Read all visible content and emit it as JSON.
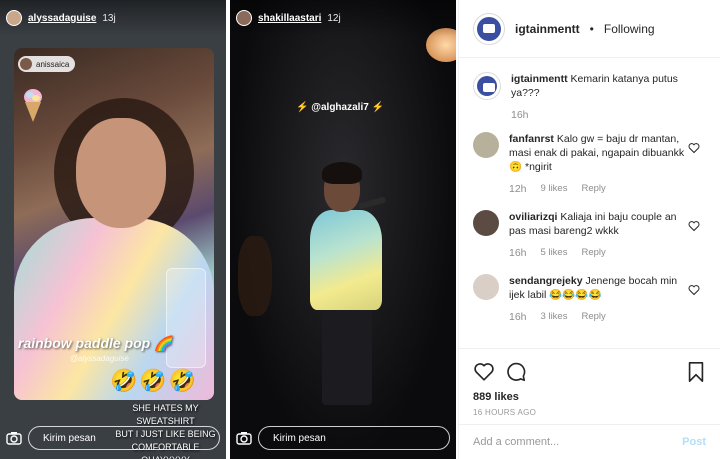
{
  "story_left": {
    "username": "alyssadaguise",
    "time": "13j",
    "mention_user": "anissaica",
    "sticker_text": "rainbow paddle pop",
    "sticker_mention": "@alyssadaguise",
    "emojis": "🤣🤣🤣",
    "caption": [
      "SHE HATES MY SWEATSHIRT",
      "BUT I JUST LIKE BEING",
      "COMFORTABLE OHAYYYYY"
    ],
    "message_placeholder": "Kirim pesan"
  },
  "story_mid": {
    "username": "shakillaastari",
    "time": "12j",
    "mention": "⚡ @alghazali7 ⚡",
    "message_placeholder": "Kirim pesan"
  },
  "post": {
    "username": "igtainmentt",
    "separator": "•",
    "follow_status": "Following",
    "caption": {
      "user": "igtainmentt",
      "text": "Kemarin katanya putus ya???",
      "time": "16h"
    },
    "comments": [
      {
        "user": "fanfanrst",
        "text": "Kalo gw = baju dr mantan, masi enak di pakai, ngapain dibuankk 🙃 *ngirit",
        "time": "12h",
        "likes": "9 likes",
        "reply": "Reply"
      },
      {
        "user": "oviliarizqi",
        "text": "Kaliaja ini baju couple an pas masi bareng2 wkkk",
        "time": "16h",
        "likes": "5 likes",
        "reply": "Reply"
      },
      {
        "user": "sendangrejeky",
        "text": "Jenenge bocah min ijek labil 😂😂😂😂",
        "time": "16h",
        "likes": "3 likes",
        "reply": "Reply"
      }
    ],
    "likes": "889 likes",
    "ago": "16 HOURS AGO",
    "add_comment_placeholder": "Add a comment...",
    "post_button": "Post"
  }
}
